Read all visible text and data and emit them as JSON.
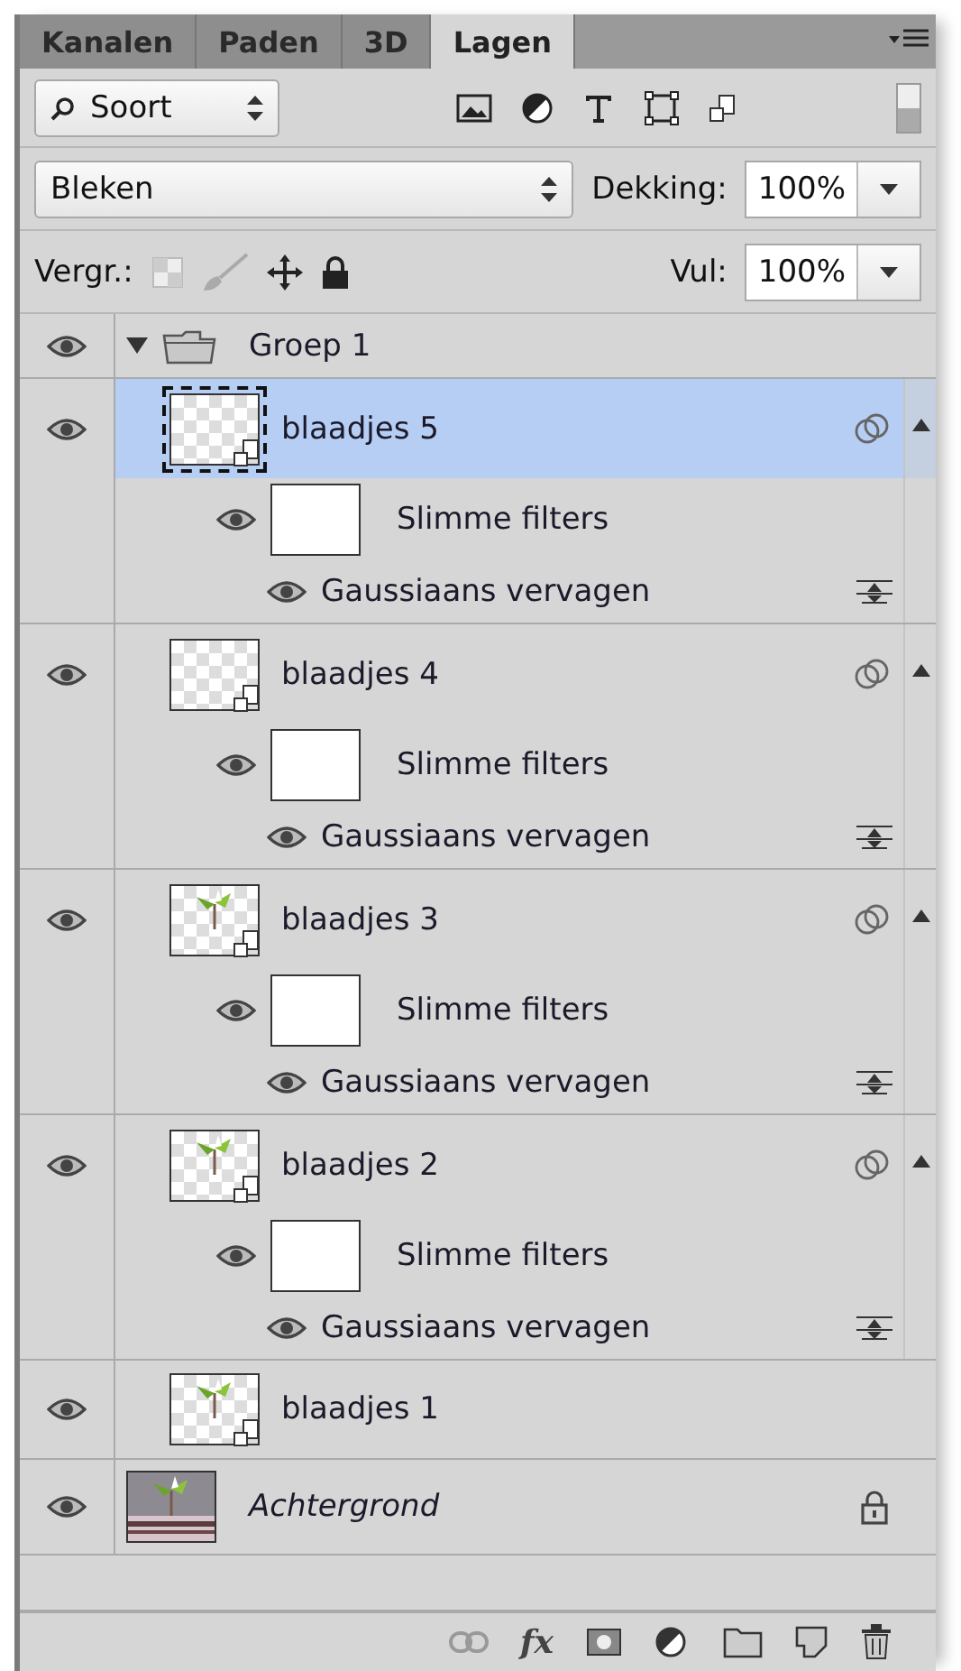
{
  "tabs": [
    {
      "label": "Kanalen",
      "selected": false
    },
    {
      "label": "Paden",
      "selected": false
    },
    {
      "label": "3D",
      "selected": false
    },
    {
      "label": "Lagen",
      "selected": true
    }
  ],
  "filter": {
    "value": "Soort"
  },
  "blend_mode": {
    "value": "Bleken"
  },
  "opacity": {
    "label": "Dekking:",
    "value": "100%"
  },
  "lock": {
    "label": "Vergr.:"
  },
  "fill": {
    "label": "Vul:",
    "value": "100%"
  },
  "layers": [
    {
      "kind": "group",
      "name": "Groep 1",
      "visible": true,
      "expanded": true,
      "children": [
        {
          "kind": "smart",
          "name": "blaadjes 5",
          "selected": true,
          "visible": true,
          "leaf": false,
          "filters_label": "Slimme filters",
          "filters_visible": true,
          "filters": [
            {
              "name": "Gaussiaans vervagen",
              "visible": true
            }
          ]
        },
        {
          "kind": "smart",
          "name": "blaadjes 4",
          "selected": false,
          "visible": true,
          "leaf": false,
          "filters_label": "Slimme filters",
          "filters_visible": true,
          "filters": [
            {
              "name": "Gaussiaans vervagen",
              "visible": true
            }
          ]
        },
        {
          "kind": "smart",
          "name": "blaadjes 3",
          "selected": false,
          "visible": true,
          "leaf": true,
          "filters_label": "Slimme filters",
          "filters_visible": true,
          "filters": [
            {
              "name": "Gaussiaans vervagen",
              "visible": true
            }
          ]
        },
        {
          "kind": "smart",
          "name": "blaadjes 2",
          "selected": false,
          "visible": true,
          "leaf": true,
          "filters_label": "Slimme filters",
          "filters_visible": true,
          "filters": [
            {
              "name": "Gaussiaans vervagen",
              "visible": true
            }
          ]
        },
        {
          "kind": "smart",
          "name": "blaadjes 1",
          "selected": false,
          "visible": true,
          "leaf": true
        }
      ]
    },
    {
      "kind": "background",
      "name": "Achtergrond",
      "visible": true,
      "locked": true
    }
  ],
  "footer": {
    "fx_label": "fx"
  }
}
